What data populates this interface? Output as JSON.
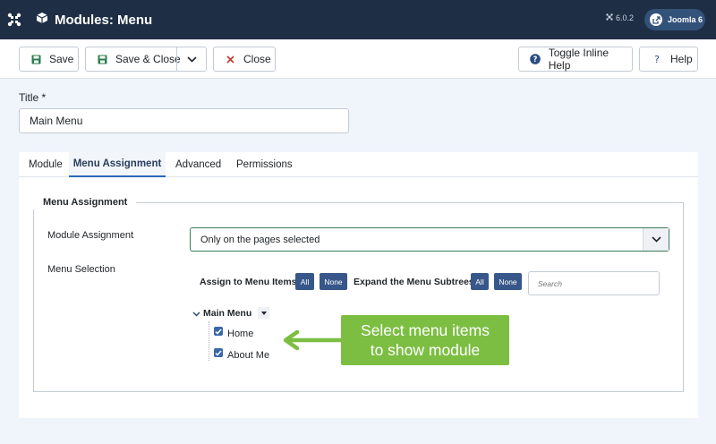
{
  "header": {
    "title": "Modules: Menu",
    "version": "6.0.2",
    "joomla_button": "Joomla 6"
  },
  "toolbar": {
    "save": "Save",
    "save_close": "Save & Close",
    "close": "Close",
    "toggle_help": "Toggle Inline Help",
    "help": "Help"
  },
  "form": {
    "title_label": "Title *",
    "title_value": "Main Menu"
  },
  "tabs": [
    {
      "label": "Module",
      "active": false
    },
    {
      "label": "Menu Assignment",
      "active": true
    },
    {
      "label": "Advanced",
      "active": false
    },
    {
      "label": "Permissions",
      "active": false
    }
  ],
  "menu_assignment": {
    "legend": "Menu Assignment",
    "module_assignment_label": "Module Assignment",
    "module_assignment_value": "Only on the pages selected",
    "menu_selection_label": "Menu Selection",
    "assign_label": "Assign to Menu Items",
    "expand_label": "Expand the Menu Subtrees",
    "all": "All",
    "none": "None",
    "search_placeholder": "Search",
    "tree": {
      "root": "Main Menu",
      "items": [
        {
          "label": "Home",
          "checked": true
        },
        {
          "label": "About Me",
          "checked": true
        }
      ]
    }
  },
  "callout": {
    "line1": "Select menu items",
    "line2": "to show module"
  },
  "colors": {
    "header_bg": "#1e2e45",
    "accent_button": "#37578a",
    "callout_green": "#7cbe42",
    "save_icon": "#2f7d4f",
    "close_icon": "#c0392b"
  }
}
